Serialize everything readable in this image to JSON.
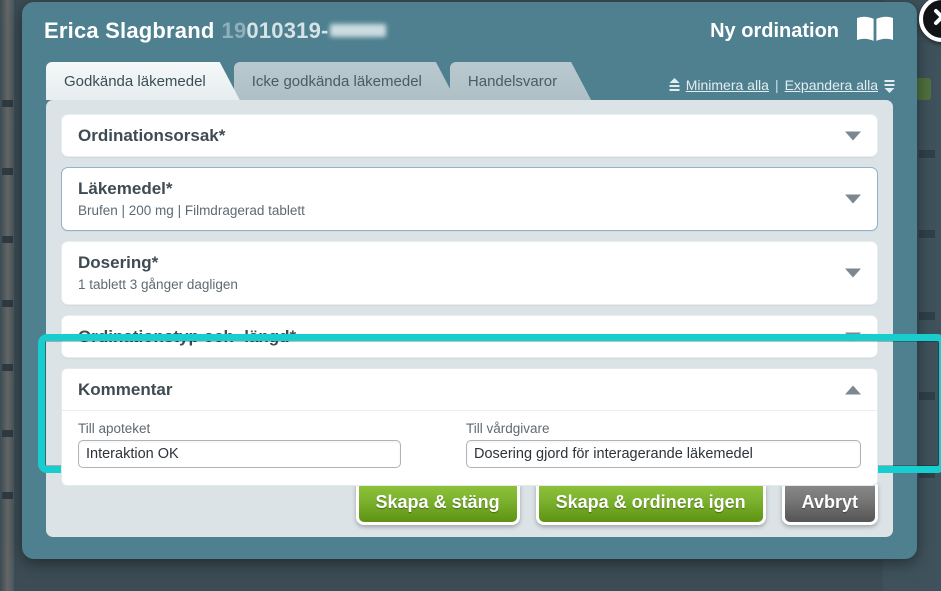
{
  "header": {
    "patient_name": "Erica Slagbrand",
    "patient_id_visible": "19",
    "patient_id_rest": "010319-",
    "title": "Ny ordination",
    "book_icon": "book-icon",
    "close_icon": "close-icon"
  },
  "tabs": [
    {
      "label": "Godkända läkemedel",
      "active": true
    },
    {
      "label": "Icke godkända läkemedel",
      "active": false
    },
    {
      "label": "Handelsvaror",
      "active": false
    }
  ],
  "tab_actions": {
    "minimize_label": "Minimera alla",
    "separator": "|",
    "expand_label": "Expandera alla",
    "minimize_icon": "collapse-all-icon",
    "expand_icon": "expand-all-icon"
  },
  "sections": [
    {
      "title": "Ordinationsorsak*",
      "subtitle": "",
      "expanded": false,
      "selected": false
    },
    {
      "title": "Läkemedel*",
      "subtitle": "Brufen | 200 mg | Filmdragerad tablett",
      "expanded": false,
      "selected": true
    },
    {
      "title": "Dosering*",
      "subtitle": "1 tablett 3 gånger dagligen",
      "expanded": false,
      "selected": false
    },
    {
      "title": "Ordinationstyp och -längd*",
      "subtitle": "",
      "expanded": false,
      "selected": false
    }
  ],
  "comment_section": {
    "title": "Kommentar",
    "expanded": true,
    "fields": [
      {
        "label": "Till apoteket",
        "value": "Interaktion OK",
        "placeholder": ""
      },
      {
        "label": "Till vårdgivare",
        "value": "Dosering gjord för interagerande läkemedel",
        "placeholder": ""
      }
    ]
  },
  "footer": {
    "buttons": [
      {
        "label": "Skapa & stäng",
        "style": "green"
      },
      {
        "label": "Skapa & ordinera igen",
        "style": "green"
      },
      {
        "label": "Avbryt",
        "style": "gray"
      }
    ]
  },
  "colors": {
    "dialog_header": "#4e8090",
    "panel_bg": "#dbe3e6",
    "highlight": "#18cdcd",
    "primary_button": "#7cb32e",
    "cancel_button": "#777777"
  }
}
